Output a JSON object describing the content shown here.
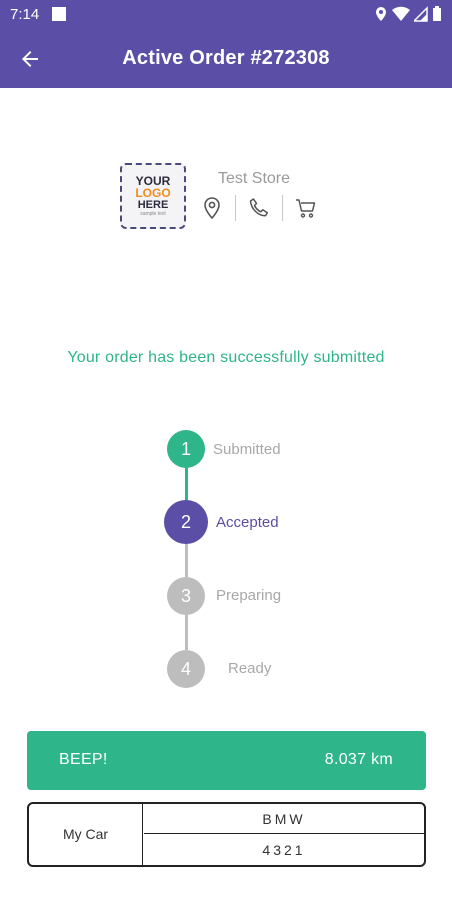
{
  "status_bar": {
    "time": "7:14"
  },
  "app_bar": {
    "title": "Active Order #272308"
  },
  "store": {
    "name": "Test Store",
    "logo_lines": [
      "YOUR",
      "LOGO",
      "HERE",
      "sample text"
    ]
  },
  "message": "Your order has been successfully submitted",
  "steps": [
    {
      "number": "1",
      "label": "Submitted",
      "state": "done"
    },
    {
      "number": "2",
      "label": "Accepted",
      "state": "current"
    },
    {
      "number": "3",
      "label": "Preparing",
      "state": "pending"
    },
    {
      "number": "4",
      "label": "Ready",
      "state": "pending"
    }
  ],
  "beep": {
    "label": "BEEP!",
    "distance": "8.037 km"
  },
  "car": {
    "label": "My Car",
    "make": "BMW",
    "plate": "4321"
  },
  "colors": {
    "primary": "#5b4ea6",
    "accent_green": "#2eb589",
    "inactive_gray": "#bdbdbd",
    "label_gray": "#a8a8a8"
  }
}
